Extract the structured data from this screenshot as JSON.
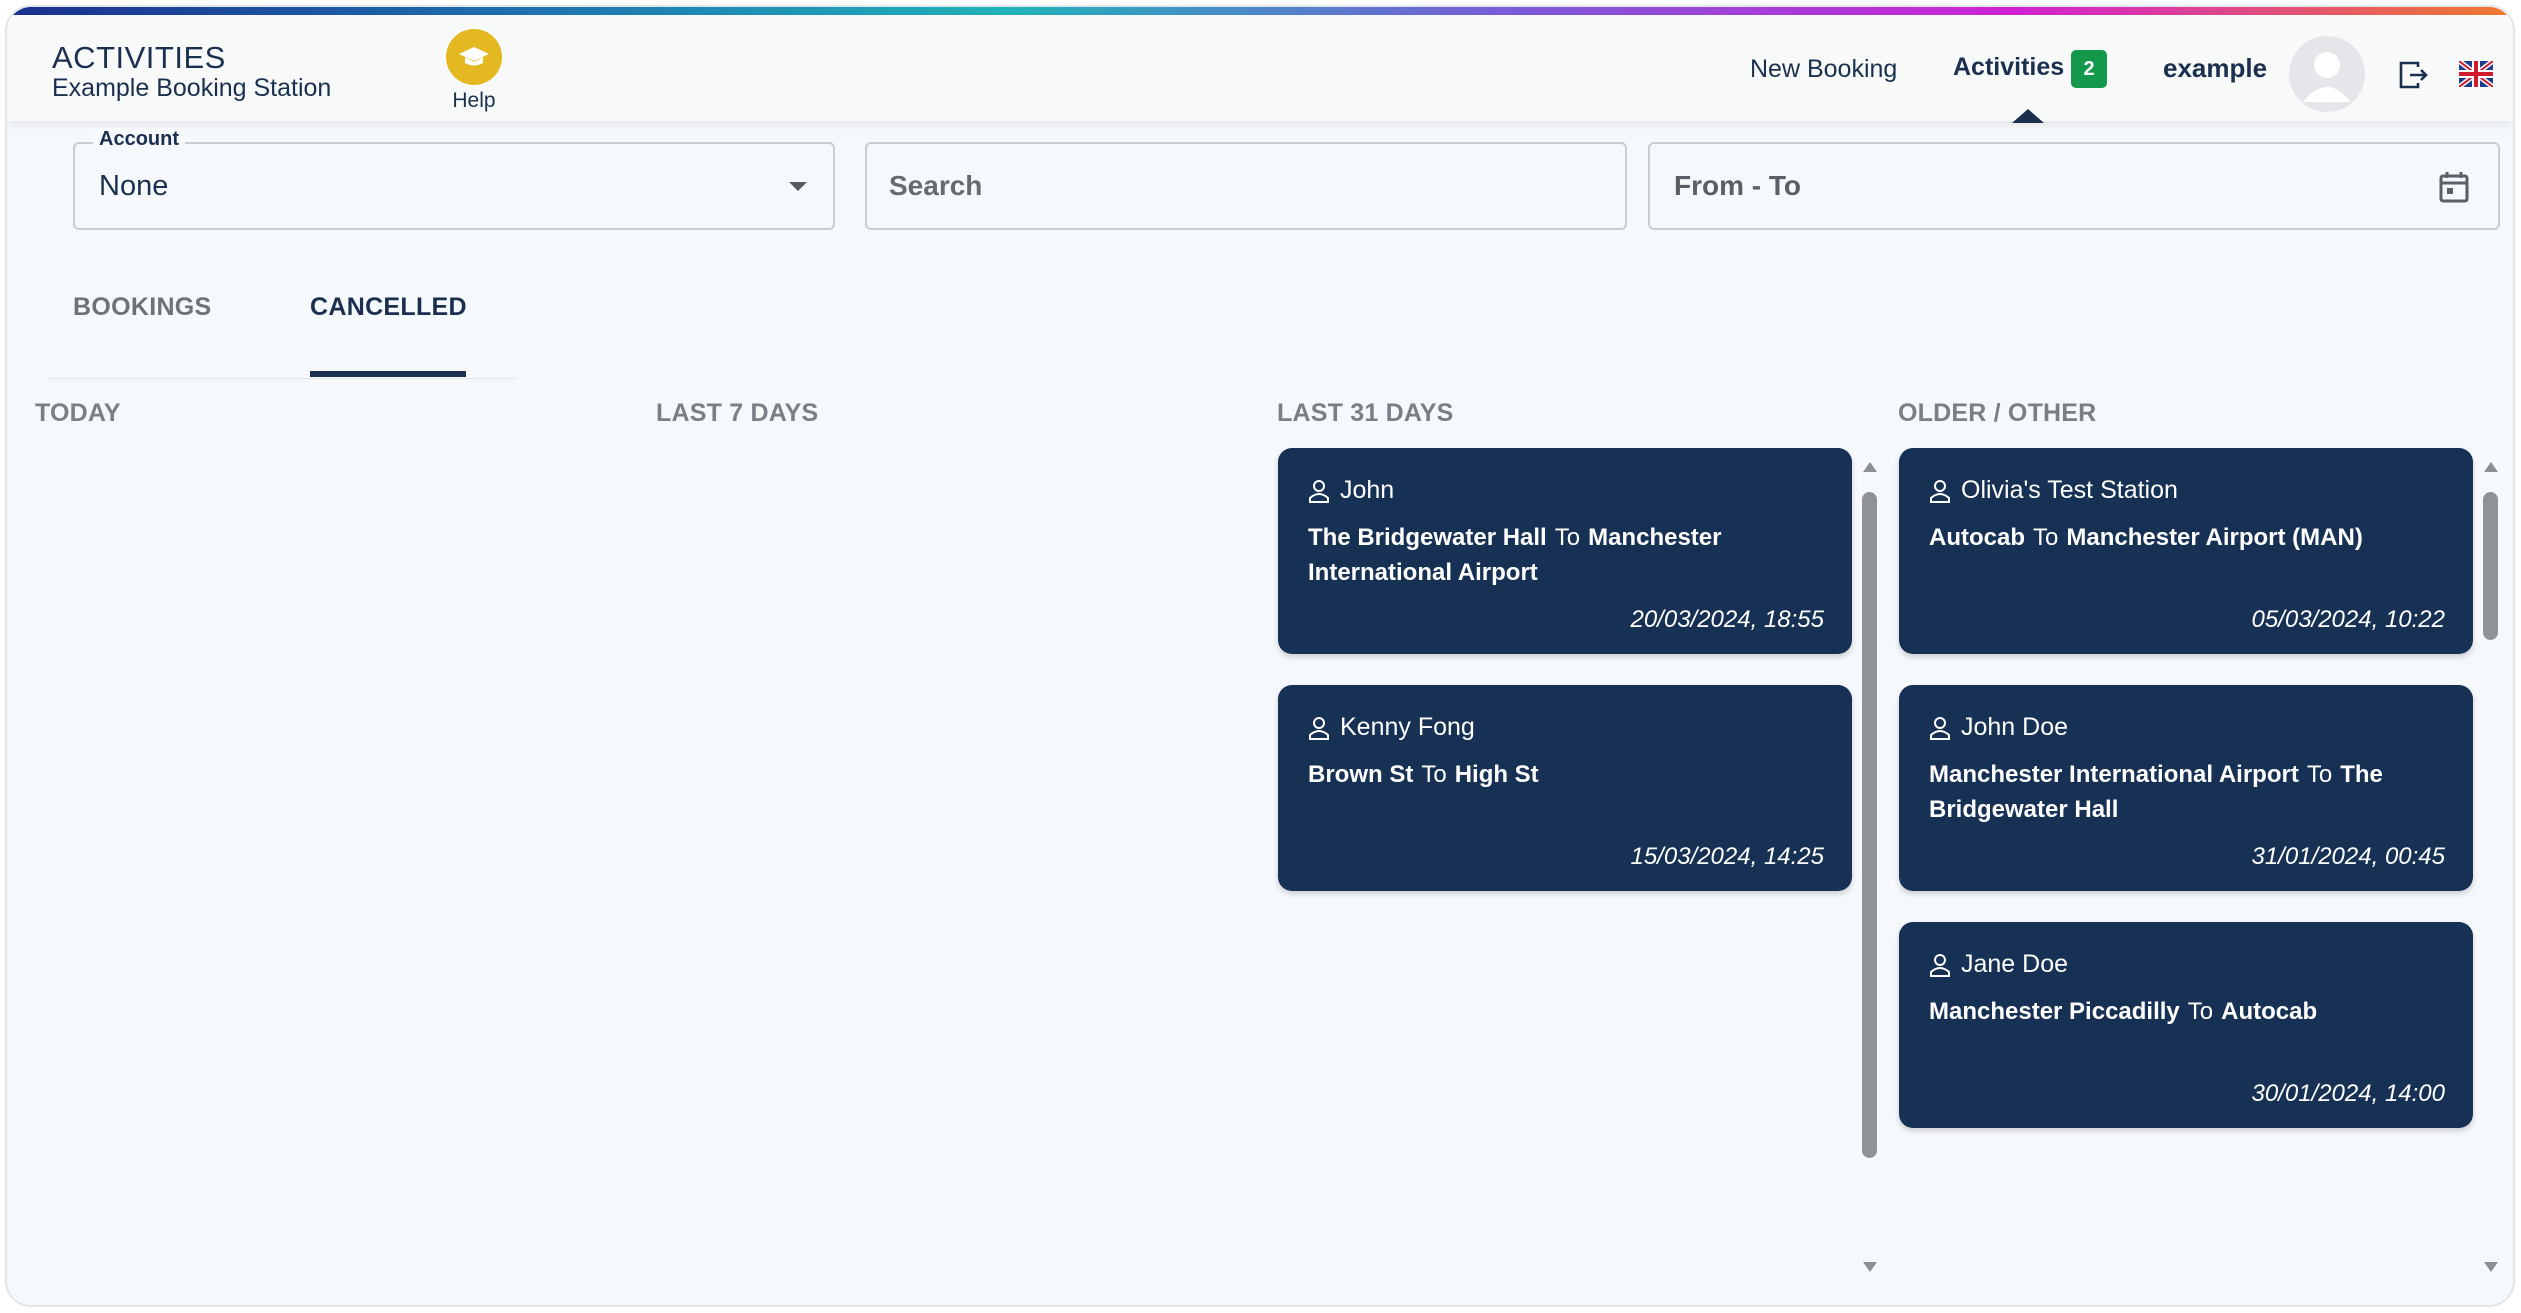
{
  "header": {
    "title": "ACTIVITIES",
    "subtitle": "Example Booking Station",
    "help_label": "Help",
    "nav_new_booking": "New Booking",
    "nav_activities": "Activities",
    "activities_badge": "2",
    "username": "example",
    "icons": [
      "graduation-cap-icon",
      "avatar-icon",
      "logout-icon",
      "uk-flag-icon"
    ]
  },
  "filters": {
    "account_label": "Account",
    "account_value": "None",
    "search_placeholder": "Search",
    "date_placeholder": "From - To"
  },
  "tabs": [
    {
      "label": "BOOKINGS",
      "active": false
    },
    {
      "label": "CANCELLED",
      "active": true
    }
  ],
  "columns": {
    "today": "TODAY",
    "last7": "LAST 7 DAYS",
    "last31": "LAST 31 DAYS",
    "older": "OLDER / OTHER"
  },
  "to_word": "To",
  "cards_last31": [
    {
      "person": "John",
      "from": "The Bridgewater Hall",
      "to": "Manchester International Airport",
      "time": "20/03/2024, 18:55"
    },
    {
      "person": "Kenny Fong",
      "from": "Brown St",
      "to": "High St",
      "time": "15/03/2024, 14:25"
    }
  ],
  "cards_older": [
    {
      "person": "Olivia's Test Station",
      "from": "Autocab",
      "to": "Manchester Airport (MAN)",
      "time": "05/03/2024, 10:22"
    },
    {
      "person": "John Doe",
      "from": "Manchester International Airport",
      "to": "The Bridgewater Hall",
      "time": "31/01/2024, 00:45"
    },
    {
      "person": "Jane Doe",
      "from": "Manchester Piccadilly",
      "to": "Autocab",
      "time": "30/01/2024, 14:00"
    }
  ],
  "colors": {
    "primary": "#173155",
    "badge": "#14984c",
    "help": "#e3b820"
  }
}
